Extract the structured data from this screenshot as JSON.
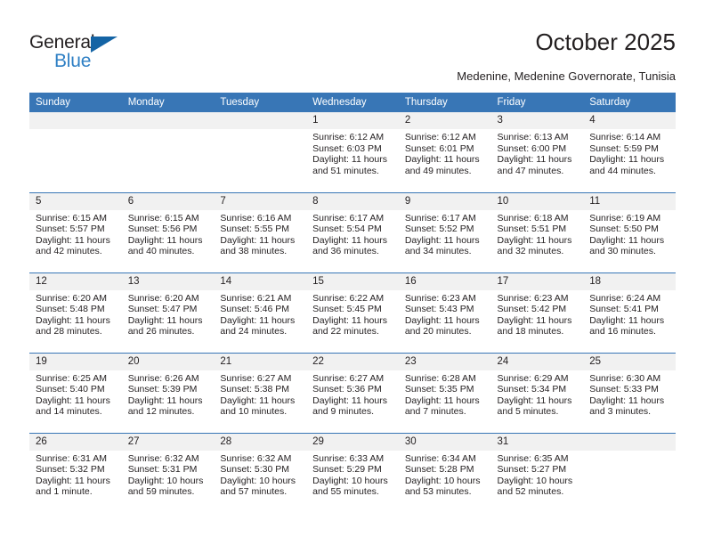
{
  "brand": {
    "name_part1": "General",
    "name_part2": "Blue",
    "accent_color": "#2e7fc4",
    "triangle_color": "#1464a5",
    "triangle_icon": "triangle-icon"
  },
  "header": {
    "title": "October 2025",
    "subtitle": "Medenine, Medenine Governorate, Tunisia"
  },
  "calendar": {
    "header_bg": "#3876b6",
    "daynum_bg": "#f1f1f1",
    "weekday_headers": [
      "Sunday",
      "Monday",
      "Tuesday",
      "Wednesday",
      "Thursday",
      "Friday",
      "Saturday"
    ],
    "weeks": [
      [
        {
          "day": "",
          "sunrise": "",
          "sunset": "",
          "daylight_line1": "",
          "daylight_line2": ""
        },
        {
          "day": "",
          "sunrise": "",
          "sunset": "",
          "daylight_line1": "",
          "daylight_line2": ""
        },
        {
          "day": "",
          "sunrise": "",
          "sunset": "",
          "daylight_line1": "",
          "daylight_line2": ""
        },
        {
          "day": "1",
          "sunrise": "Sunrise: 6:12 AM",
          "sunset": "Sunset: 6:03 PM",
          "daylight_line1": "Daylight: 11 hours",
          "daylight_line2": "and 51 minutes."
        },
        {
          "day": "2",
          "sunrise": "Sunrise: 6:12 AM",
          "sunset": "Sunset: 6:01 PM",
          "daylight_line1": "Daylight: 11 hours",
          "daylight_line2": "and 49 minutes."
        },
        {
          "day": "3",
          "sunrise": "Sunrise: 6:13 AM",
          "sunset": "Sunset: 6:00 PM",
          "daylight_line1": "Daylight: 11 hours",
          "daylight_line2": "and 47 minutes."
        },
        {
          "day": "4",
          "sunrise": "Sunrise: 6:14 AM",
          "sunset": "Sunset: 5:59 PM",
          "daylight_line1": "Daylight: 11 hours",
          "daylight_line2": "and 44 minutes."
        }
      ],
      [
        {
          "day": "5",
          "sunrise": "Sunrise: 6:15 AM",
          "sunset": "Sunset: 5:57 PM",
          "daylight_line1": "Daylight: 11 hours",
          "daylight_line2": "and 42 minutes."
        },
        {
          "day": "6",
          "sunrise": "Sunrise: 6:15 AM",
          "sunset": "Sunset: 5:56 PM",
          "daylight_line1": "Daylight: 11 hours",
          "daylight_line2": "and 40 minutes."
        },
        {
          "day": "7",
          "sunrise": "Sunrise: 6:16 AM",
          "sunset": "Sunset: 5:55 PM",
          "daylight_line1": "Daylight: 11 hours",
          "daylight_line2": "and 38 minutes."
        },
        {
          "day": "8",
          "sunrise": "Sunrise: 6:17 AM",
          "sunset": "Sunset: 5:54 PM",
          "daylight_line1": "Daylight: 11 hours",
          "daylight_line2": "and 36 minutes."
        },
        {
          "day": "9",
          "sunrise": "Sunrise: 6:17 AM",
          "sunset": "Sunset: 5:52 PM",
          "daylight_line1": "Daylight: 11 hours",
          "daylight_line2": "and 34 minutes."
        },
        {
          "day": "10",
          "sunrise": "Sunrise: 6:18 AM",
          "sunset": "Sunset: 5:51 PM",
          "daylight_line1": "Daylight: 11 hours",
          "daylight_line2": "and 32 minutes."
        },
        {
          "day": "11",
          "sunrise": "Sunrise: 6:19 AM",
          "sunset": "Sunset: 5:50 PM",
          "daylight_line1": "Daylight: 11 hours",
          "daylight_line2": "and 30 minutes."
        }
      ],
      [
        {
          "day": "12",
          "sunrise": "Sunrise: 6:20 AM",
          "sunset": "Sunset: 5:48 PM",
          "daylight_line1": "Daylight: 11 hours",
          "daylight_line2": "and 28 minutes."
        },
        {
          "day": "13",
          "sunrise": "Sunrise: 6:20 AM",
          "sunset": "Sunset: 5:47 PM",
          "daylight_line1": "Daylight: 11 hours",
          "daylight_line2": "and 26 minutes."
        },
        {
          "day": "14",
          "sunrise": "Sunrise: 6:21 AM",
          "sunset": "Sunset: 5:46 PM",
          "daylight_line1": "Daylight: 11 hours",
          "daylight_line2": "and 24 minutes."
        },
        {
          "day": "15",
          "sunrise": "Sunrise: 6:22 AM",
          "sunset": "Sunset: 5:45 PM",
          "daylight_line1": "Daylight: 11 hours",
          "daylight_line2": "and 22 minutes."
        },
        {
          "day": "16",
          "sunrise": "Sunrise: 6:23 AM",
          "sunset": "Sunset: 5:43 PM",
          "daylight_line1": "Daylight: 11 hours",
          "daylight_line2": "and 20 minutes."
        },
        {
          "day": "17",
          "sunrise": "Sunrise: 6:23 AM",
          "sunset": "Sunset: 5:42 PM",
          "daylight_line1": "Daylight: 11 hours",
          "daylight_line2": "and 18 minutes."
        },
        {
          "day": "18",
          "sunrise": "Sunrise: 6:24 AM",
          "sunset": "Sunset: 5:41 PM",
          "daylight_line1": "Daylight: 11 hours",
          "daylight_line2": "and 16 minutes."
        }
      ],
      [
        {
          "day": "19",
          "sunrise": "Sunrise: 6:25 AM",
          "sunset": "Sunset: 5:40 PM",
          "daylight_line1": "Daylight: 11 hours",
          "daylight_line2": "and 14 minutes."
        },
        {
          "day": "20",
          "sunrise": "Sunrise: 6:26 AM",
          "sunset": "Sunset: 5:39 PM",
          "daylight_line1": "Daylight: 11 hours",
          "daylight_line2": "and 12 minutes."
        },
        {
          "day": "21",
          "sunrise": "Sunrise: 6:27 AM",
          "sunset": "Sunset: 5:38 PM",
          "daylight_line1": "Daylight: 11 hours",
          "daylight_line2": "and 10 minutes."
        },
        {
          "day": "22",
          "sunrise": "Sunrise: 6:27 AM",
          "sunset": "Sunset: 5:36 PM",
          "daylight_line1": "Daylight: 11 hours",
          "daylight_line2": "and 9 minutes."
        },
        {
          "day": "23",
          "sunrise": "Sunrise: 6:28 AM",
          "sunset": "Sunset: 5:35 PM",
          "daylight_line1": "Daylight: 11 hours",
          "daylight_line2": "and 7 minutes."
        },
        {
          "day": "24",
          "sunrise": "Sunrise: 6:29 AM",
          "sunset": "Sunset: 5:34 PM",
          "daylight_line1": "Daylight: 11 hours",
          "daylight_line2": "and 5 minutes."
        },
        {
          "day": "25",
          "sunrise": "Sunrise: 6:30 AM",
          "sunset": "Sunset: 5:33 PM",
          "daylight_line1": "Daylight: 11 hours",
          "daylight_line2": "and 3 minutes."
        }
      ],
      [
        {
          "day": "26",
          "sunrise": "Sunrise: 6:31 AM",
          "sunset": "Sunset: 5:32 PM",
          "daylight_line1": "Daylight: 11 hours",
          "daylight_line2": "and 1 minute."
        },
        {
          "day": "27",
          "sunrise": "Sunrise: 6:32 AM",
          "sunset": "Sunset: 5:31 PM",
          "daylight_line1": "Daylight: 10 hours",
          "daylight_line2": "and 59 minutes."
        },
        {
          "day": "28",
          "sunrise": "Sunrise: 6:32 AM",
          "sunset": "Sunset: 5:30 PM",
          "daylight_line1": "Daylight: 10 hours",
          "daylight_line2": "and 57 minutes."
        },
        {
          "day": "29",
          "sunrise": "Sunrise: 6:33 AM",
          "sunset": "Sunset: 5:29 PM",
          "daylight_line1": "Daylight: 10 hours",
          "daylight_line2": "and 55 minutes."
        },
        {
          "day": "30",
          "sunrise": "Sunrise: 6:34 AM",
          "sunset": "Sunset: 5:28 PM",
          "daylight_line1": "Daylight: 10 hours",
          "daylight_line2": "and 53 minutes."
        },
        {
          "day": "31",
          "sunrise": "Sunrise: 6:35 AM",
          "sunset": "Sunset: 5:27 PM",
          "daylight_line1": "Daylight: 10 hours",
          "daylight_line2": "and 52 minutes."
        },
        {
          "day": "",
          "sunrise": "",
          "sunset": "",
          "daylight_line1": "",
          "daylight_line2": ""
        }
      ]
    ]
  }
}
